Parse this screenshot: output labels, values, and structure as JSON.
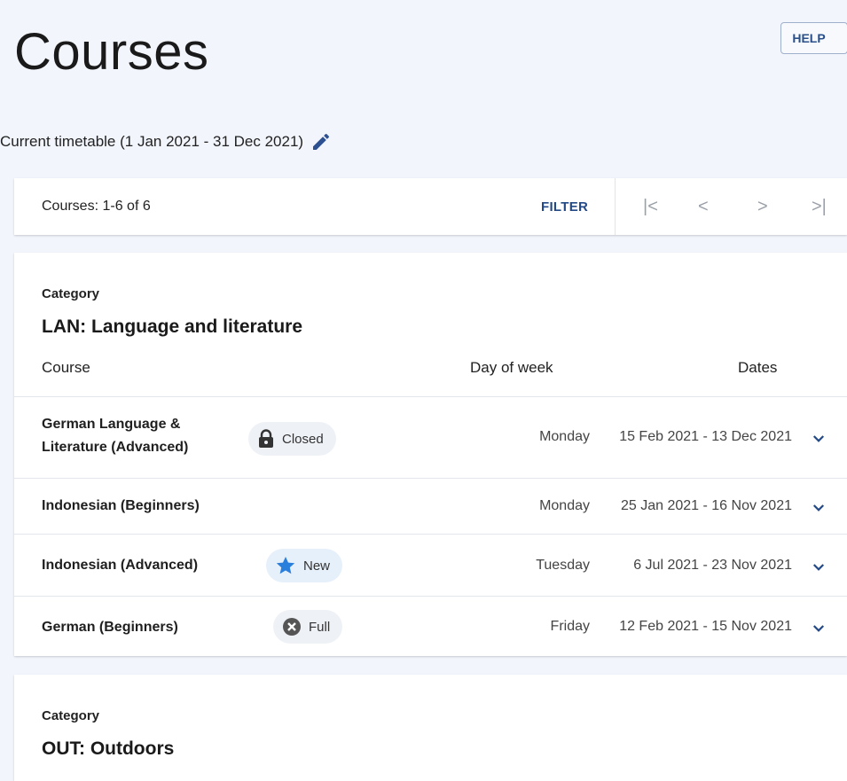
{
  "page": {
    "title": "Courses",
    "help_label": "HELP"
  },
  "timetable": {
    "label": "Current timetable (1 Jan 2021 - 31 Dec 2021)"
  },
  "toolbar": {
    "count_text": "Courses: 1-6 of 6",
    "filter_label": "FILTER"
  },
  "categories": [
    {
      "category_label": "Category",
      "name": "LAN: Language and literature",
      "columns": {
        "course": "Course",
        "day": "Day of week",
        "dates": "Dates"
      },
      "courses": [
        {
          "name": "German Language & Literature (Advanced)",
          "badge": "Closed",
          "badge_icon": "lock-icon",
          "day": "Monday",
          "dates": "15 Feb 2021 - 13 Dec 2021"
        },
        {
          "name": "Indonesian (Beginners)",
          "badge": "",
          "day": "Monday",
          "dates": "25 Jan 2021 - 16 Nov 2021"
        },
        {
          "name": "Indonesian (Advanced)",
          "badge": "New",
          "badge_icon": "star-icon",
          "day": "Tuesday",
          "dates": "6 Jul 2021 - 23 Nov 2021"
        },
        {
          "name": "German (Beginners)",
          "badge": "Full",
          "badge_icon": "x-circle-icon",
          "day": "Friday",
          "dates": "12 Feb 2021 - 15 Nov 2021"
        }
      ]
    },
    {
      "category_label": "Category",
      "name": "OUT: Outdoors"
    }
  ],
  "colors": {
    "accent": "#234a86",
    "star": "#2b7fdc",
    "background": "#f2f5fc"
  }
}
